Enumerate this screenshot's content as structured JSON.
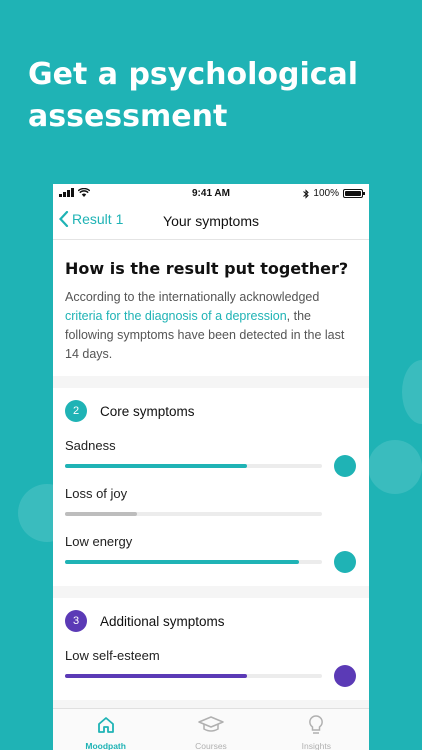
{
  "headline": "Get a psychological assessment",
  "status_bar": {
    "time": "9:41 AM",
    "battery": "100%"
  },
  "nav": {
    "back_label": "Result 1",
    "title": "Your symptoms"
  },
  "intro": {
    "heading": "How is the result put together?",
    "text_before": "According to the internationally acknowledged ",
    "link_text": "criteria for the diagnosis of a depression",
    "text_after": ", the following symptoms have been detected in the last 14 days."
  },
  "groups": [
    {
      "number": "2",
      "title": "Core symptoms",
      "color": "#1fb3b5",
      "symptoms": [
        {
          "label": "Sadness",
          "level": 0.71,
          "color": "#1fb3b5",
          "dot": true
        },
        {
          "label": "Loss of joy",
          "level": 0.28,
          "color": "#bdbdbd",
          "dot": false
        },
        {
          "label": "Low energy",
          "level": 0.91,
          "color": "#1fb3b5",
          "dot": true
        }
      ]
    },
    {
      "number": "3",
      "title": "Additional symptoms",
      "color": "#5b3ab6",
      "symptoms": [
        {
          "label": "Low self-esteem",
          "level": 0.71,
          "color": "#5b3ab6",
          "dot": true
        }
      ]
    }
  ],
  "tabs": [
    {
      "label": "Moodpath",
      "icon": "home-icon",
      "active": true
    },
    {
      "label": "Courses",
      "icon": "graduation-cap-icon",
      "active": false
    },
    {
      "label": "Insights",
      "icon": "lightbulb-icon",
      "active": false
    }
  ],
  "colors": {
    "accent": "#1fb3b5",
    "purple": "#5b3ab6",
    "inactive": "#b0b0b0"
  }
}
